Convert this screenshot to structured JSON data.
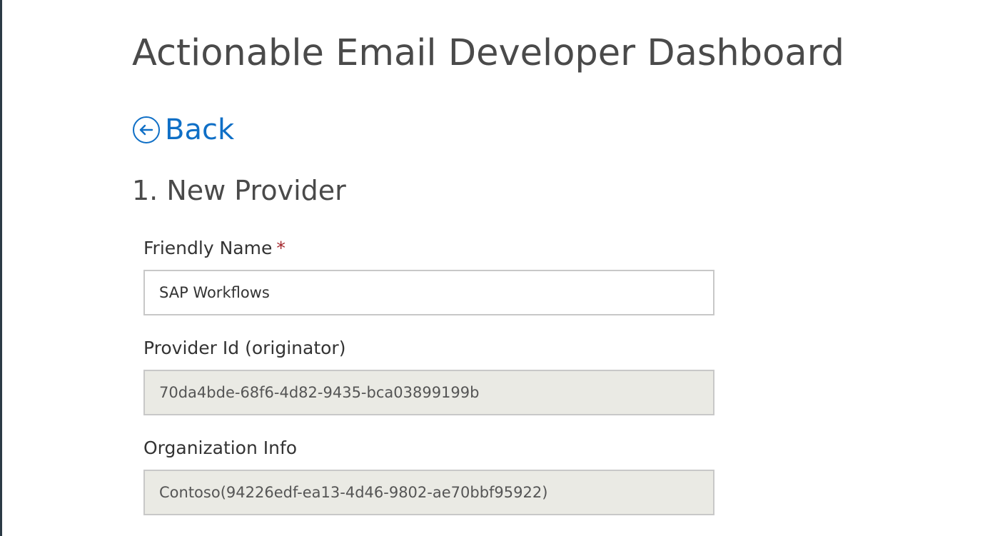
{
  "header": {
    "title": "Actionable Email Developer Dashboard"
  },
  "nav": {
    "back_label": "Back",
    "back_icon": "arrow-left-circle-icon"
  },
  "section": {
    "title": "1. New Provider"
  },
  "form": {
    "friendly_name": {
      "label": "Friendly Name",
      "required_marker": "*",
      "value": "SAP Workflows"
    },
    "provider_id": {
      "label": "Provider Id (originator)",
      "value": "70da4bde-68f6-4d82-9435-bca03899199b"
    },
    "organization_info": {
      "label": "Organization Info",
      "value": "Contoso(94226edf-ea13-4d46-9802-ae70bbf95922)"
    }
  },
  "colors": {
    "link": "#0f6fc6",
    "required": "#a4262c",
    "readonly_bg": "#eaeae4",
    "input_border": "#c8c8c8",
    "title_text": "#4a4a4a"
  }
}
